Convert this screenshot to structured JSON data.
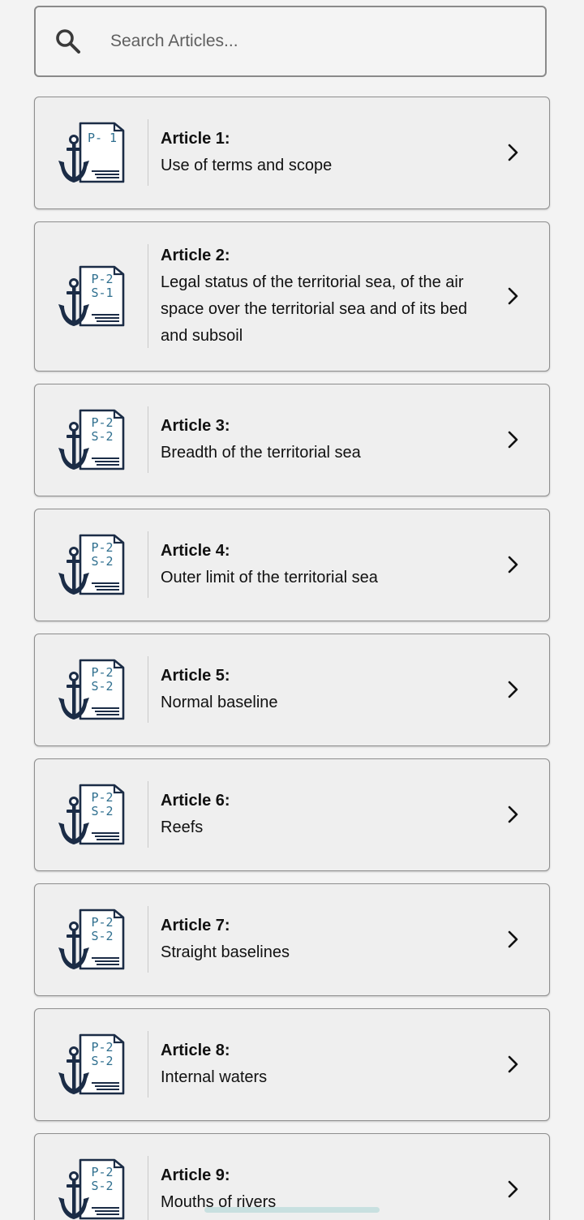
{
  "search": {
    "placeholder": "Search Articles..."
  },
  "colors": {
    "icon_navy": "#1b2c46",
    "icon_teal": "#2f6f8f",
    "background": "#f3f3f3",
    "card": "#efefef"
  },
  "articles": [
    {
      "title": "Article 1:",
      "line1": "Use of terms and scope",
      "line2": "",
      "line3": "",
      "badge1": "P- 1",
      "badge2": "",
      "icon": "anchor-document-icon"
    },
    {
      "title": "Article 2:",
      "line1": "Legal status of the territorial sea, of the air",
      "line2": "space over the territorial sea and of its bed",
      "line3": "and subsoil",
      "badge1": "P-2",
      "badge2": "S-1",
      "icon": "anchor-document-icon"
    },
    {
      "title": "Article 3:",
      "line1": "Breadth of the territorial sea",
      "line2": "",
      "line3": "",
      "badge1": "P-2",
      "badge2": "S-2",
      "icon": "anchor-document-icon"
    },
    {
      "title": "Article 4:",
      "line1": "Outer limit of the territorial sea",
      "line2": "",
      "line3": "",
      "badge1": "P-2",
      "badge2": "S-2",
      "icon": "anchor-document-icon"
    },
    {
      "title": "Article 5:",
      "line1": "Normal baseline",
      "line2": "",
      "line3": "",
      "badge1": "P-2",
      "badge2": "S-2",
      "icon": "anchor-document-icon"
    },
    {
      "title": "Article 6:",
      "line1": "Reefs",
      "line2": "",
      "line3": "",
      "badge1": "P-2",
      "badge2": "S-2",
      "icon": "anchor-document-icon"
    },
    {
      "title": "Article 7:",
      "line1": "Straight baselines",
      "line2": "",
      "line3": "",
      "badge1": "P-2",
      "badge2": "S-2",
      "icon": "anchor-document-icon"
    },
    {
      "title": "Article 8:",
      "line1": "Internal waters",
      "line2": "",
      "line3": "",
      "badge1": "P-2",
      "badge2": "S-2",
      "icon": "anchor-document-icon"
    },
    {
      "title": "Article 9:",
      "line1": "Mouths of rivers",
      "line2": "",
      "line3": "",
      "badge1": "P-2",
      "badge2": "S-2",
      "icon": "anchor-document-icon"
    }
  ]
}
